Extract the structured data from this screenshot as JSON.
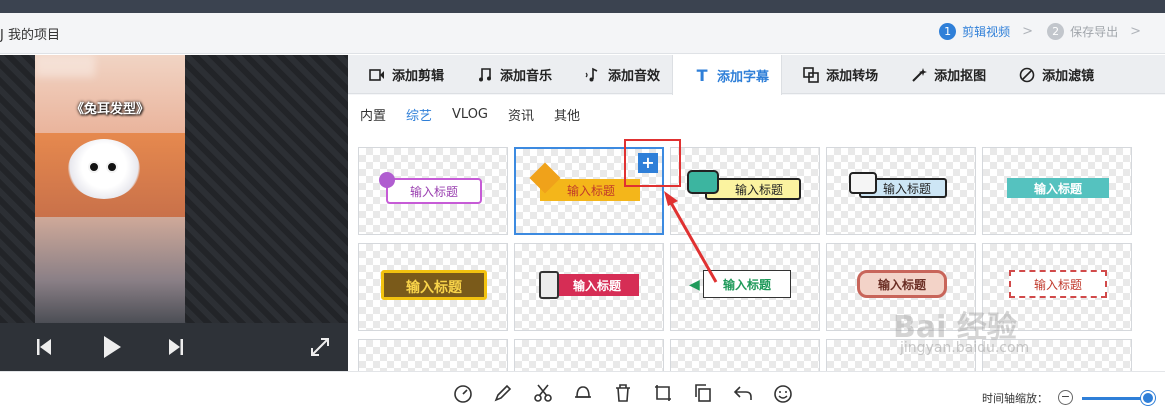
{
  "header": {
    "breadcrumb": "J 我的项目",
    "steps": [
      {
        "num": "1",
        "label": "剪辑视频"
      },
      {
        "num": "2",
        "label": "保存导出"
      }
    ]
  },
  "preview": {
    "caption": "《兔耳发型》"
  },
  "tabs": [
    {
      "label": "添加剪辑",
      "icon": "video-camera-icon"
    },
    {
      "label": "添加音乐",
      "icon": "music-note-icon"
    },
    {
      "label": "添加音效",
      "icon": "sound-effect-icon"
    },
    {
      "label": "添加字幕",
      "icon": "text-t-icon"
    },
    {
      "label": "添加转场",
      "icon": "transition-icon"
    },
    {
      "label": "添加抠图",
      "icon": "magic-wand-icon"
    },
    {
      "label": "添加滤镜",
      "icon": "filter-icon"
    }
  ],
  "subcategories": [
    "内置",
    "综艺",
    "VLOG",
    "资讯",
    "其他"
  ],
  "active_subcategory": "综艺",
  "templates": {
    "row1": [
      "输入标题",
      "输入标题",
      "输入标题",
      "输入标题",
      "输入标题"
    ],
    "row2": [
      "输入标题",
      "输入标题",
      "输入标题",
      "输入标题",
      "输入标题"
    ]
  },
  "add_button": "+",
  "bottom": {
    "zoom_label": "时间轴缩放：",
    "zoom_minus": "−",
    "zoom_level": 0.95
  },
  "watermark": {
    "main": "Bai 经验",
    "sub": "jingyan.baidu.com"
  },
  "colors": {
    "accent": "#2f7fd8",
    "highlight": "#e03131"
  }
}
